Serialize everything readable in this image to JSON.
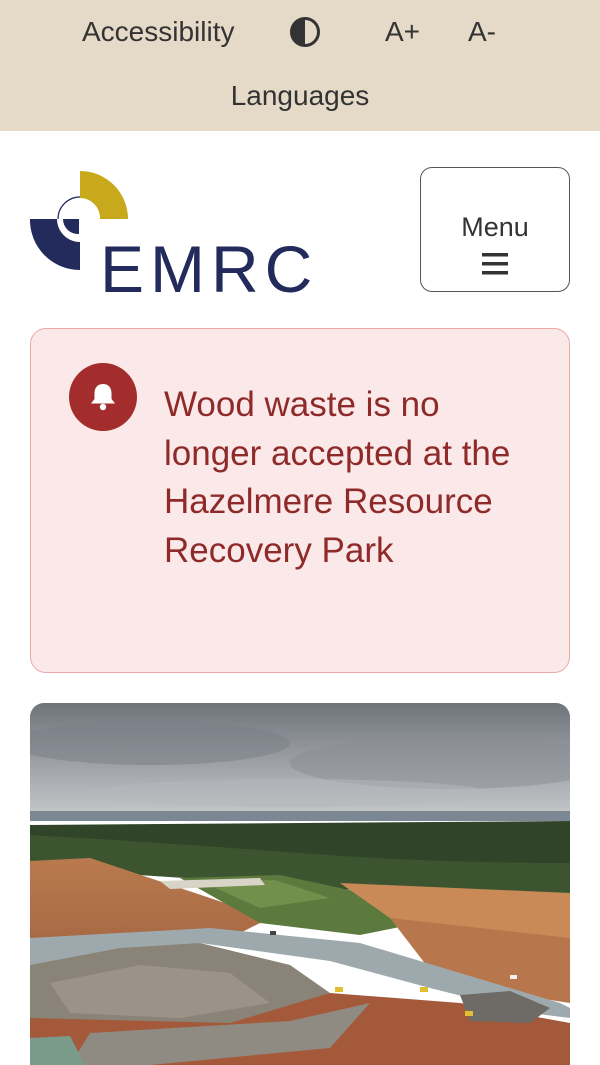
{
  "accessibility_bar": {
    "label": "Accessibility",
    "contrast_icon": "contrast-icon",
    "font_increase": "A+",
    "font_decrease": "A-",
    "languages": "Languages"
  },
  "header": {
    "logo_text": "EMRC",
    "menu_label": "Menu",
    "menu_icon": "hamburger-icon"
  },
  "alert": {
    "icon": "bell-icon",
    "message": "Wood waste is no longer accepted at the Hazelmere Resource Recovery Park"
  },
  "colors": {
    "access_bar_bg": "#e5dac8",
    "logo_navy": "#232a5c",
    "logo_gold": "#c9a91c",
    "alert_bg": "#fbe8e8",
    "alert_border": "#eea8a8",
    "alert_text": "#8f2a2a",
    "alert_icon_bg": "#a32d2d"
  }
}
